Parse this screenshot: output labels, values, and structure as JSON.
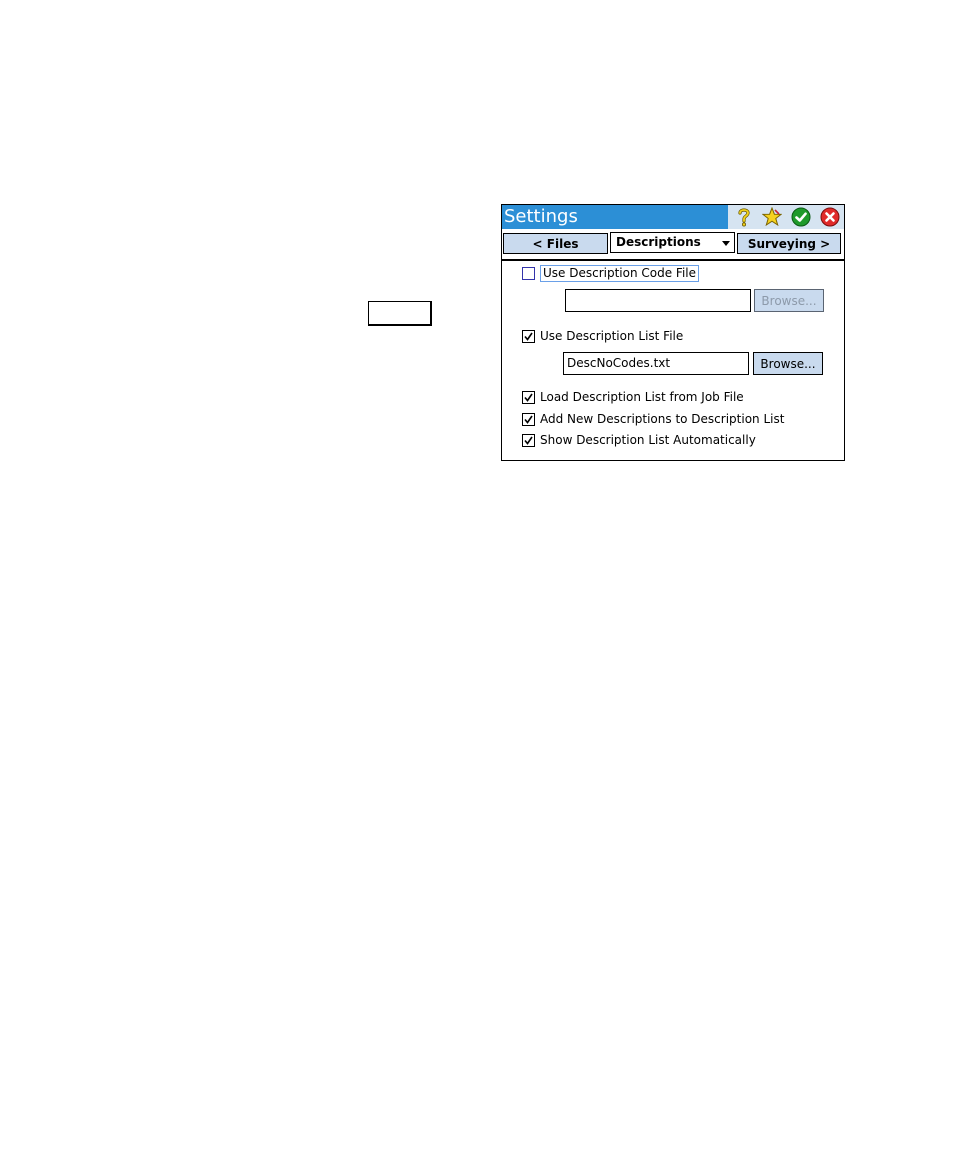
{
  "window": {
    "title": "Settings",
    "icons": [
      "help-icon",
      "favorites-star-icon",
      "ok-check-icon",
      "close-x-icon"
    ]
  },
  "nav": {
    "prev_label": "< Files",
    "current_page": "Descriptions",
    "next_label": "Surveying >"
  },
  "options": {
    "use_code_file": {
      "label": "Use Description Code File",
      "checked": false
    },
    "code_file": {
      "value": "",
      "browse_label": "Browse..."
    },
    "use_list_file": {
      "label": "Use Description List File",
      "checked": true
    },
    "list_file": {
      "value": "DescNoCodes.txt",
      "browse_label": "Browse..."
    },
    "load_from_job": {
      "label": "Load Description List from Job File",
      "checked": true
    },
    "add_new": {
      "label": "Add New Descriptions to Description List",
      "checked": true
    },
    "show_auto": {
      "label": "Show Description List Automatically",
      "checked": true
    }
  },
  "colors": {
    "titlebar": "#2c8fd6",
    "button": "#c9daee"
  }
}
